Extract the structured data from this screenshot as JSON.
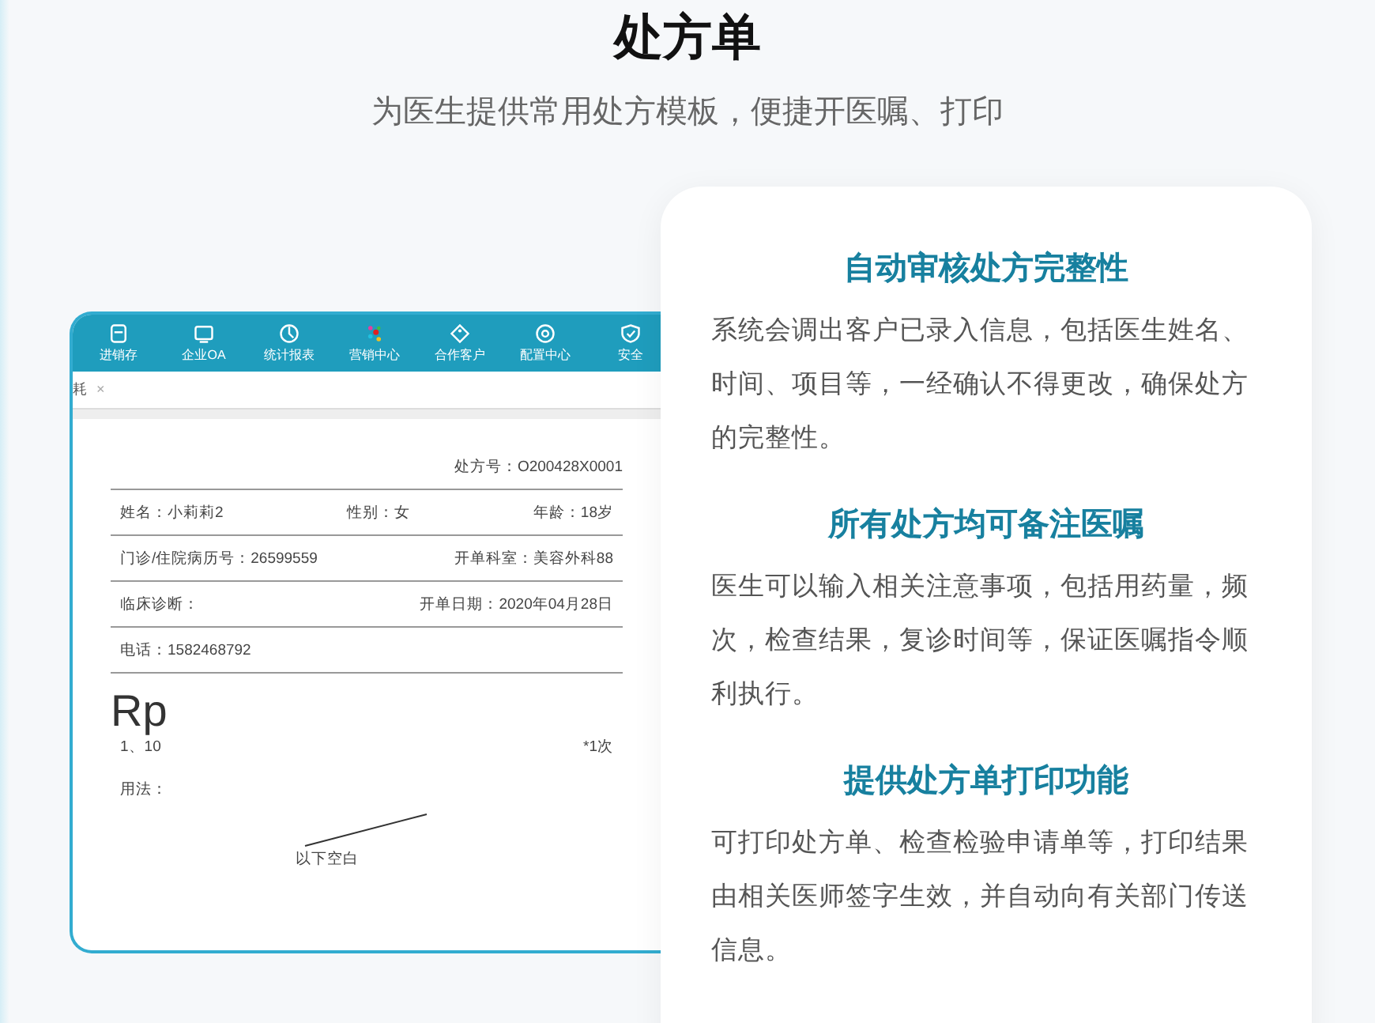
{
  "title": "处方单",
  "subtitle": "为医生提供常用处方模板，便捷开医嘱、打印",
  "app": {
    "nav": [
      {
        "label": "进销存"
      },
      {
        "label": "企业OA"
      },
      {
        "label": "统计报表"
      },
      {
        "label": "营销中心"
      },
      {
        "label": "合作客户"
      },
      {
        "label": "配置中心"
      },
      {
        "label": "安全"
      }
    ],
    "tab": {
      "label": "耗",
      "close": "×"
    },
    "prescription": {
      "number": "处方号：O200428X0001",
      "rows": [
        [
          "姓名：小莉莉2",
          "性别：女",
          "年龄：18岁"
        ],
        [
          "门诊/住院病历号：26599559",
          "开单科室：美容外科88"
        ],
        [
          "临床诊断：",
          "开单日期：2020年04月28日"
        ],
        [
          "电话：1582468792"
        ]
      ],
      "rp": "Rp",
      "item": "1、10",
      "dose": "*1次",
      "usage": "用法：",
      "blank": "以下空白"
    }
  },
  "features": [
    {
      "heading": "自动审核处方完整性",
      "text": "系统会调出客户已录入信息，包括医生姓名、时间、项目等，一经确认不得更改，确保处方的完整性。"
    },
    {
      "heading": "所有处方均可备注医嘱",
      "text": "医生可以输入相关注意事项，包括用药量，频次，检查结果，复诊时间等，保证医嘱指令顺利执行。"
    },
    {
      "heading": "提供处方单打印功能",
      "text": "可打印处方单、检查检验申请单等，打印结果由相关医师签字生效，并自动向有关部门传送信息。"
    }
  ]
}
